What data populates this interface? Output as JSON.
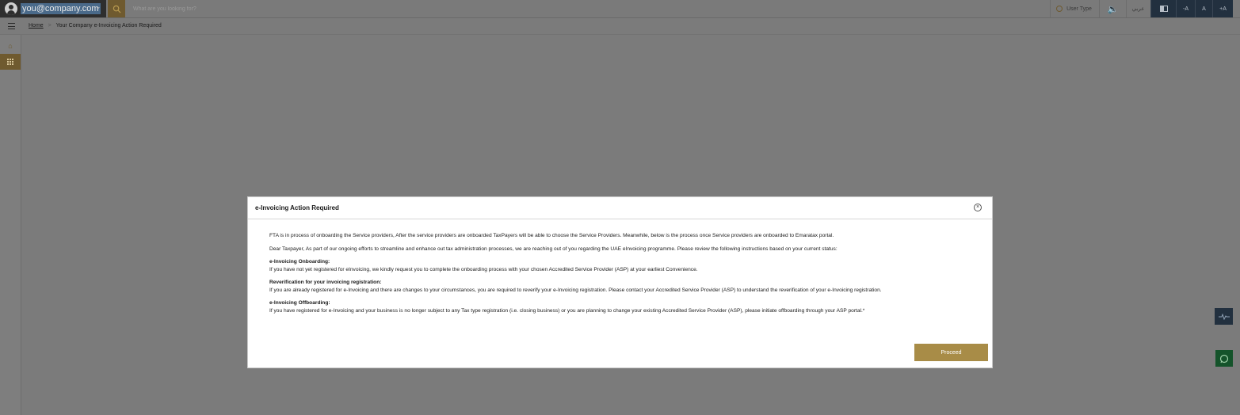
{
  "topbar": {
    "user_email": "you@company.com",
    "search_placeholder": "What are you looking for?",
    "user_type_label": "User Type",
    "arabic_label": "عربي",
    "font_decrease_label": "-A",
    "font_normal_label": "A",
    "font_increase_label": "+A"
  },
  "breadcrumb": {
    "home": "Home",
    "company": "Your Company",
    "current": "e-Invoicing Action Required"
  },
  "modal": {
    "title": "e-Invoicing Action Required",
    "intro": "FTA is in process of onboarding the Service providers, After the service providers are onboarded TaxPayers will be able to choose the Service Providers. Meanwhile, below is the process once Service providers are onboarded to Emaratax portal.",
    "dear": "Dear Taxpayer, As part of our ongoing efforts to streamline and enhance out tax administration processes, we are reaching out of you regarding the UAE eInvoicing programme. Please review the following instructions based on your current status:",
    "sections": [
      {
        "heading": "e-Invoicing Onboarding:",
        "text": "If you have not yet registered for eInvoicing, we kindly request you to complete the onboarding process with your chosen Accredited Service Provider (ASP) at your earliest Convenience."
      },
      {
        "heading": "Reverification for your invoicing registration:",
        "text": "If you are already registered for e-Invoicing and there are changes to your circumstances, you are required to reverify your e-Invoicing registration. Please contact your Accredited Service Provider (ASP) to understand the reverification of your e-Invoicing registration."
      },
      {
        "heading": "e-Invoicing Offboarding:",
        "text": "If you have registered for e-Invoicing and your business is no longer subject to any Tax type registration (i.e. closing business) or you are planning to change your existing Accredited Service Provider (ASP), please initiate offboarding through your ASP portal.*"
      }
    ],
    "proceed_label": "Proceed"
  },
  "colors": {
    "accent": "#a88c47",
    "dark_navy": "#22303f",
    "overlay": "#7b7b7b"
  }
}
